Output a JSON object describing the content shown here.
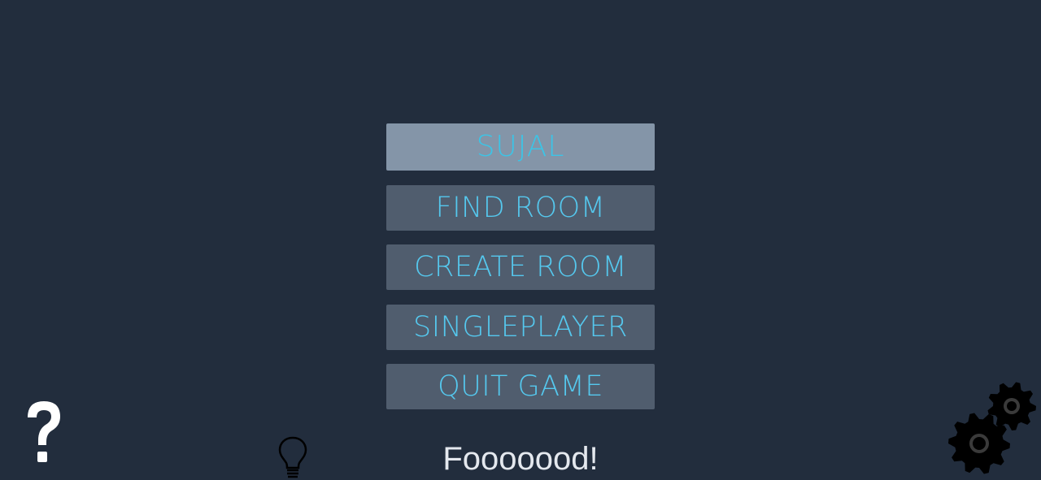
{
  "menu": {
    "player_name": "SUJAL",
    "buttons": {
      "find_room": "FIND ROOM",
      "create_room": "CREATE ROOM",
      "singleplayer": "SINGLEPLAYER",
      "quit_game": "QUIT GAME"
    }
  },
  "tip": {
    "text": "Fooooood!"
  },
  "icons": {
    "help": "help-icon",
    "hint": "lightbulb-icon",
    "settings": "gear-icon"
  },
  "colors": {
    "background": "#222d3d",
    "button_bg": "#505d6e",
    "name_field_bg": "#8495a8",
    "button_text": "#55c8ee",
    "tip_text": "#e4e8ee"
  }
}
